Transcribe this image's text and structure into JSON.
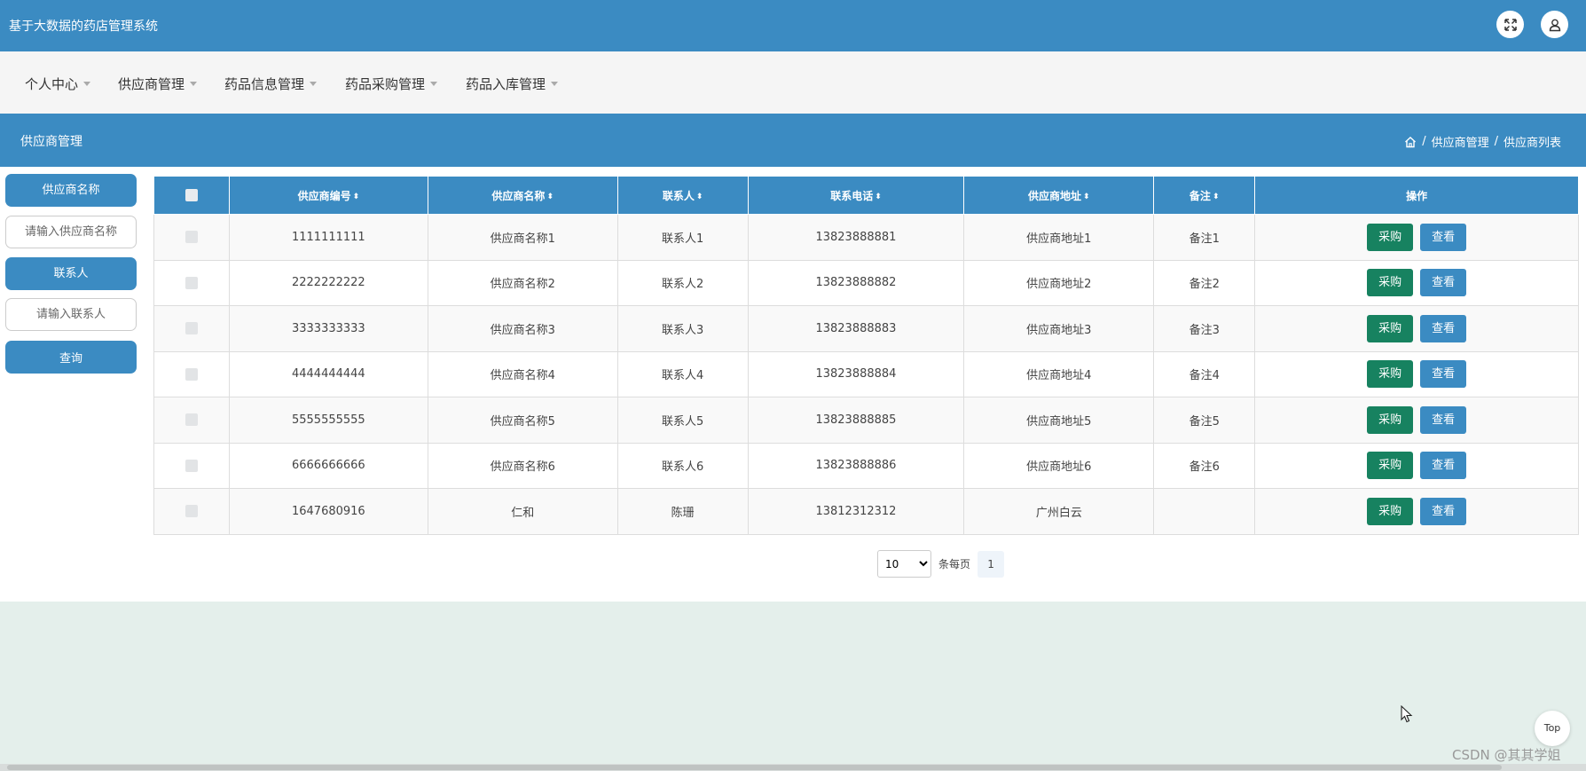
{
  "app": {
    "title": "基于大数据的药店管理系统"
  },
  "header_icons": [
    "expand-icon",
    "user-icon"
  ],
  "nav": {
    "items": [
      {
        "label": "个人中心"
      },
      {
        "label": "供应商管理"
      },
      {
        "label": "药品信息管理"
      },
      {
        "label": "药品采购管理"
      },
      {
        "label": "药品入库管理"
      }
    ]
  },
  "section": {
    "title": "供应商管理",
    "breadcrumb": [
      "供应商管理",
      "供应商列表"
    ]
  },
  "search": {
    "name_label": "供应商名称",
    "name_placeholder": "请输入供应商名称",
    "contact_label": "联系人",
    "contact_placeholder": "请输入联系人",
    "query_button": "查询"
  },
  "table": {
    "columns": [
      "供应商编号",
      "供应商名称",
      "联系人",
      "联系电话",
      "供应商地址",
      "备注",
      "操作"
    ],
    "rows": [
      {
        "id": "1111111111",
        "name": "供应商名称1",
        "contact": "联系人1",
        "phone": "13823888881",
        "address": "供应商地址1",
        "remark": "备注1"
      },
      {
        "id": "2222222222",
        "name": "供应商名称2",
        "contact": "联系人2",
        "phone": "13823888882",
        "address": "供应商地址2",
        "remark": "备注2"
      },
      {
        "id": "3333333333",
        "name": "供应商名称3",
        "contact": "联系人3",
        "phone": "13823888883",
        "address": "供应商地址3",
        "remark": "备注3"
      },
      {
        "id": "4444444444",
        "name": "供应商名称4",
        "contact": "联系人4",
        "phone": "13823888884",
        "address": "供应商地址4",
        "remark": "备注4"
      },
      {
        "id": "5555555555",
        "name": "供应商名称5",
        "contact": "联系人5",
        "phone": "13823888885",
        "address": "供应商地址5",
        "remark": "备注5"
      },
      {
        "id": "6666666666",
        "name": "供应商名称6",
        "contact": "联系人6",
        "phone": "13823888886",
        "address": "供应商地址6",
        "remark": "备注6"
      },
      {
        "id": "1647680916",
        "name": "仁和",
        "contact": "陈珊",
        "phone": "13812312312",
        "address": "广州白云",
        "remark": ""
      }
    ],
    "actions": {
      "buy": "采购",
      "view": "查看"
    }
  },
  "pagination": {
    "page_size": "10",
    "page_size_options": [
      "10"
    ],
    "per_page_label": "条每页",
    "current_page": "1"
  },
  "back_to_top": "Top",
  "watermark": "CSDN @其其学姐",
  "colors": {
    "primary": "#3b8bc2",
    "buy": "#178260",
    "background": "#e4efeb"
  }
}
